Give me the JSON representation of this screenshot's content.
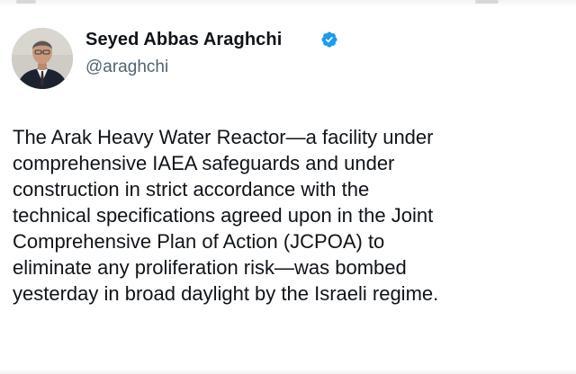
{
  "author": {
    "name": "Seyed Abbas Araghchi",
    "handle": "@araghchi",
    "verified_color": "#1d9bf0",
    "avatar_icon": "profile-photo"
  },
  "tweet": {
    "lines": [
      "The Arak Heavy Water Reactor—a facility under",
      "comprehensive IAEA safeguards and under",
      "construction in strict accordance with the",
      "technical specifications agreed upon in the Joint",
      "Comprehensive Plan of Action (JCPOA) to",
      "eliminate any proliferation risk—was bombed",
      "yesterday in broad daylight by the Israeli regime."
    ]
  }
}
